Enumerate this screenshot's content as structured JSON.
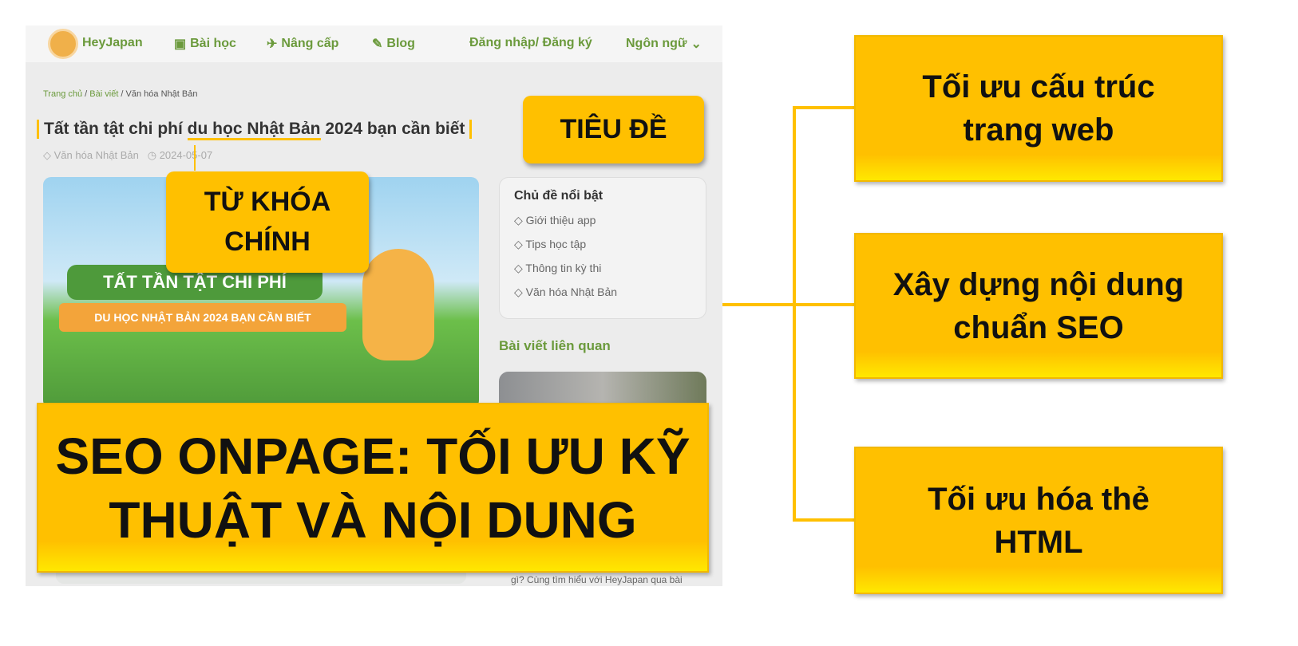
{
  "nav": {
    "brand": "HeyJapan",
    "items": [
      "Bài học",
      "Nâng cấp",
      "Blog"
    ],
    "login": "Đăng nhập/ Đăng ký",
    "language": "Ngôn ngữ"
  },
  "breadcrumb": [
    "Trang chủ",
    "Bài viết",
    "Văn hóa Nhật Bản"
  ],
  "article": {
    "title_before": "Tất tần tật chi phí ",
    "keyword": "du học Nhật Bản",
    "title_after": " 2024 bạn cần biết",
    "category": "Văn hóa Nhật Bản",
    "date": "2024-05-07",
    "banner_line1": "TẤT TẦN TẬT CHI PHÍ",
    "banner_line2": "DU HỌC NHẬT BẢN 2024 BẠN CẦN BIẾT"
  },
  "sidebar": {
    "topics_title": "Chủ đề nổi bật",
    "topics": [
      "Giới thiệu app",
      "Tips học tập",
      "Thông tin kỳ thi",
      "Văn hóa Nhật Bản"
    ],
    "related_title": "Bài viết liên quan",
    "snippet": "gì? Cùng tìm hiểu với HeyJapan qua bài"
  },
  "callouts": {
    "title_label": "TIÊU ĐỀ",
    "keyword_label": "TỪ KHÓA CHÍNH",
    "main_line1": "SEO ONPAGE: TỐI ƯU KỸ",
    "main_line2": "THUẬT VÀ NỘI DUNG"
  },
  "branches": [
    "Tối ưu cấu trúc trang web",
    "Xây dựng nội dung chuẩn SEO",
    "Tối ưu hóa thẻ HTML"
  ],
  "colors": {
    "accent": "#ffc000",
    "brand_green": "#6b9a3c"
  }
}
